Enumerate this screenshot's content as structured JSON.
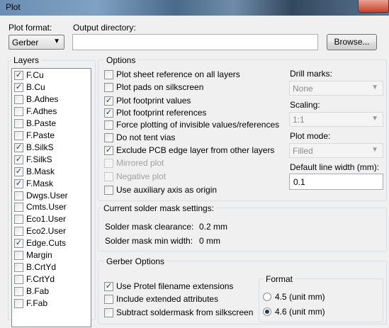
{
  "window": {
    "title": "Plot"
  },
  "plot_format": {
    "label": "Plot format:",
    "value": "Gerber"
  },
  "output_directory": {
    "label": "Output directory:",
    "value": "",
    "browse_label": "Browse..."
  },
  "layers": {
    "title": "Layers",
    "items": [
      {
        "label": "F.Cu",
        "checked": true
      },
      {
        "label": "B.Cu",
        "checked": true
      },
      {
        "label": "B.Adhes",
        "checked": false
      },
      {
        "label": "F.Adhes",
        "checked": false
      },
      {
        "label": "B.Paste",
        "checked": false
      },
      {
        "label": "F.Paste",
        "checked": false
      },
      {
        "label": "B.SilkS",
        "checked": true
      },
      {
        "label": "F.SilkS",
        "checked": true
      },
      {
        "label": "B.Mask",
        "checked": true
      },
      {
        "label": "F.Mask",
        "checked": true
      },
      {
        "label": "Dwgs.User",
        "checked": false
      },
      {
        "label": "Cmts.User",
        "checked": false
      },
      {
        "label": "Eco1.User",
        "checked": false
      },
      {
        "label": "Eco2.User",
        "checked": false
      },
      {
        "label": "Edge.Cuts",
        "checked": true
      },
      {
        "label": "Margin",
        "checked": false
      },
      {
        "label": "B.CrtYd",
        "checked": false
      },
      {
        "label": "F.CrtYd",
        "checked": false
      },
      {
        "label": "B.Fab",
        "checked": false
      },
      {
        "label": "F.Fab",
        "checked": false
      }
    ]
  },
  "options": {
    "title": "Options",
    "checkboxes": [
      {
        "label": "Plot sheet reference on all layers",
        "checked": false,
        "enabled": true
      },
      {
        "label": "Plot pads on silkscreen",
        "checked": false,
        "enabled": true
      },
      {
        "label": "Plot footprint values",
        "checked": true,
        "enabled": true
      },
      {
        "label": "Plot footprint references",
        "checked": true,
        "enabled": true
      },
      {
        "label": "Force plotting of invisible values/references",
        "checked": false,
        "enabled": true
      },
      {
        "label": "Do not tent vias",
        "checked": false,
        "enabled": true
      },
      {
        "label": "Exclude PCB edge layer from other layers",
        "checked": true,
        "enabled": true
      },
      {
        "label": "Mirrored plot",
        "checked": false,
        "enabled": false
      },
      {
        "label": "Negative plot",
        "checked": false,
        "enabled": false
      },
      {
        "label": "Use auxiliary axis as origin",
        "checked": false,
        "enabled": true
      }
    ],
    "drill_marks": {
      "label": "Drill marks:",
      "value": "None"
    },
    "scaling": {
      "label": "Scaling:",
      "value": "1:1"
    },
    "plot_mode": {
      "label": "Plot mode:",
      "value": "Filled"
    },
    "line_width": {
      "label": "Default line width (mm):",
      "value": "0.1"
    }
  },
  "solder_mask": {
    "title": "Current solder mask settings:",
    "clearance_label": "Solder mask clearance:",
    "clearance_value": "0.2 mm",
    "min_width_label": "Solder mask min width:",
    "min_width_value": "0 mm"
  },
  "gerber_options": {
    "title": "Gerber Options",
    "checkboxes": [
      {
        "label": "Use Protel filename extensions",
        "checked": true
      },
      {
        "label": "Include extended attributes",
        "checked": false
      },
      {
        "label": "Subtract soldermask from silkscreen",
        "checked": false
      }
    ],
    "format": {
      "title": "Format",
      "options": [
        {
          "label": "4.5 (unit mm)",
          "selected": false
        },
        {
          "label": "4.6 (unit mm)",
          "selected": true
        }
      ]
    }
  }
}
